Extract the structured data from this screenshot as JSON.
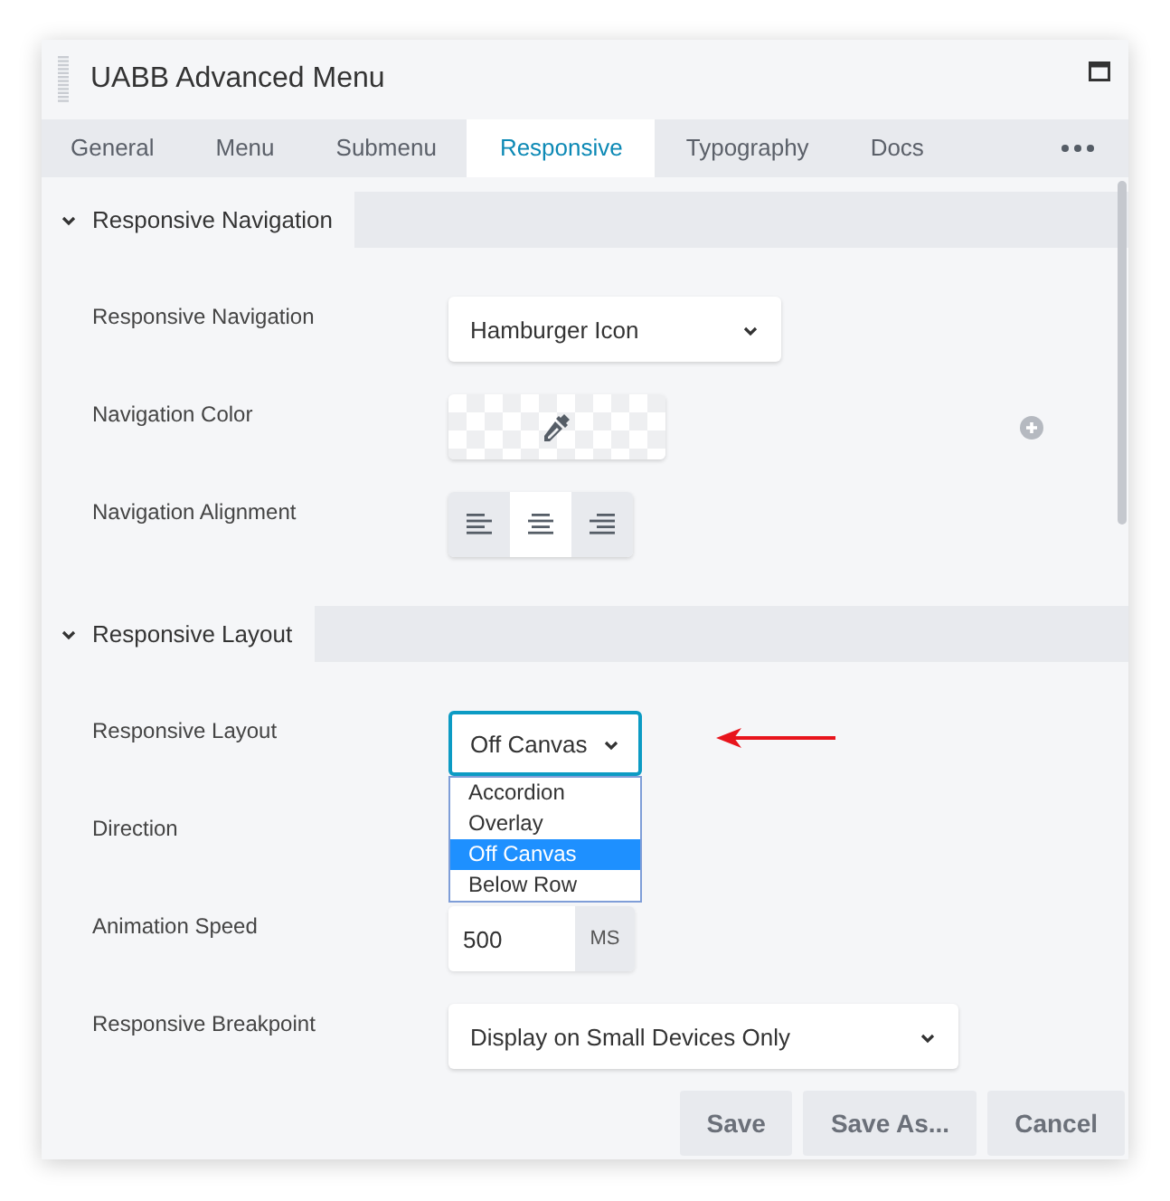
{
  "window": {
    "title": "UABB Advanced Menu"
  },
  "tabs": [
    {
      "label": "General",
      "selected": false
    },
    {
      "label": "Menu",
      "selected": false
    },
    {
      "label": "Submenu",
      "selected": false
    },
    {
      "label": "Responsive",
      "selected": true
    },
    {
      "label": "Typography",
      "selected": false
    },
    {
      "label": "Docs",
      "selected": false
    }
  ],
  "sections": [
    {
      "title": "Responsive Navigation",
      "expanded": true,
      "fields": [
        {
          "kind": "select",
          "label": "Responsive Navigation",
          "value": "Hamburger Icon"
        },
        {
          "kind": "color",
          "label": "Navigation Color"
        },
        {
          "kind": "align",
          "label": "Navigation Alignment",
          "options": [
            {
              "selected": false
            },
            {
              "selected": true
            },
            {
              "selected": false
            }
          ]
        }
      ]
    },
    {
      "title": "Responsive Layout",
      "expanded": true,
      "fields": [
        {
          "kind": "select",
          "label": "Responsive Layout",
          "value": "Off Canvas",
          "focused": true,
          "open": true,
          "options": [
            {
              "label": "Accordion",
              "selected": false
            },
            {
              "label": "Overlay",
              "selected": false
            },
            {
              "label": "Off Canvas",
              "selected": true
            },
            {
              "label": "Below Row",
              "selected": false
            }
          ]
        },
        {
          "kind": "hidden",
          "label": "Direction"
        },
        {
          "kind": "number",
          "label": "Animation Speed",
          "value": "500",
          "unit": "MS"
        },
        {
          "kind": "wideselect",
          "label": "Responsive Breakpoint",
          "value": "Display on Small Devices Only"
        }
      ]
    }
  ],
  "buttons": [
    "Save",
    "Save As...",
    "Cancel"
  ]
}
